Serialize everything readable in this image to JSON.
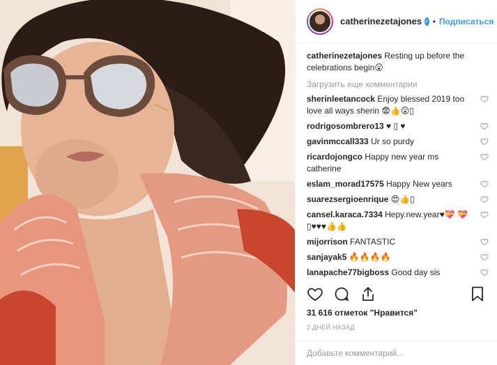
{
  "post": {
    "username": "catherinezetajones",
    "dot": "•",
    "follow_label": "Подписаться",
    "caption_user": "catherinezetajones",
    "caption_text": " Resting up before the celebrations begin😮",
    "load_more": "Загрузить еще комментарии",
    "comments": [
      {
        "user": "sherinleetancock",
        "text": " Enjoy blessed 2019 too love all ways sherin 😨👍😮▯"
      },
      {
        "user": "rodrigosombrero13",
        "text": " ♥ ▯ ♥"
      },
      {
        "user": "gavinmccall333",
        "text": " Ur so purdy"
      },
      {
        "user": "ricardojongco",
        "text": " Happy new year ms catherine"
      },
      {
        "user": "eslam_morad17575",
        "text": " Happy New years"
      },
      {
        "user": "suarezsergioenrique",
        "text": " 😍👍▯"
      },
      {
        "user": "cansel.karaca.7334",
        "text": " Hepy.new.year♥💝 💝▯♥♥♥👍👍"
      },
      {
        "user": "mijorrison",
        "text": " FANTASTIC"
      },
      {
        "user": "sanjayak5",
        "text": " 🔥🔥🔥🔥"
      },
      {
        "user": "lanapache77bigboss",
        "text": " Good day sis"
      }
    ],
    "likes": "31 616 отметок \"Нравится\"",
    "time": "2 ДНЕЙ НАЗАД",
    "add_comment_placeholder": "Добавьте комментарий..."
  },
  "colors": {
    "accent": "#3897f0",
    "muted": "#999999",
    "text": "#262626",
    "border": "#efefef"
  },
  "icons": [
    "heart-icon",
    "comment-icon",
    "share-icon",
    "bookmark-icon",
    "verified-badge-icon"
  ]
}
